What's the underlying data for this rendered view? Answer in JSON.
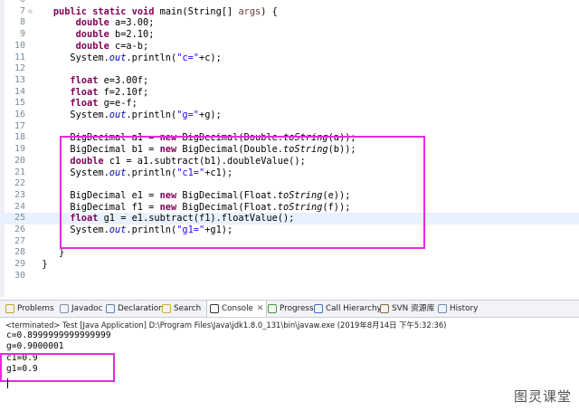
{
  "editor": {
    "lines": [
      {
        "n": "6",
        "tokens": [],
        "fold": ""
      },
      {
        "n": "7",
        "fold": "⊖",
        "tokens": [
          [
            "    ",
            ""
          ],
          [
            "public",
            "kw"
          ],
          [
            " ",
            ""
          ],
          [
            "static",
            "kw"
          ],
          [
            " ",
            ""
          ],
          [
            "void",
            "kw"
          ],
          [
            " main(String[] ",
            ""
          ],
          [
            "args",
            "pm"
          ],
          [
            ") {",
            ""
          ]
        ]
      },
      {
        "n": "8",
        "tokens": [
          [
            "        ",
            ""
          ],
          [
            "double",
            "kw"
          ],
          [
            " a=3.00;",
            ""
          ]
        ]
      },
      {
        "n": "9",
        "tokens": [
          [
            "        ",
            ""
          ],
          [
            "double",
            "kw"
          ],
          [
            " b=2.10;",
            ""
          ]
        ]
      },
      {
        "n": "10",
        "tokens": [
          [
            "        ",
            ""
          ],
          [
            "double",
            "kw"
          ],
          [
            " c=a-b;",
            ""
          ]
        ]
      },
      {
        "n": "11",
        "tokens": [
          [
            "       System.",
            ""
          ],
          [
            "out",
            "fld"
          ],
          [
            ".println(",
            ""
          ],
          [
            "\"c=\"",
            "st"
          ],
          [
            "+c);",
            ""
          ]
        ]
      },
      {
        "n": "12",
        "tokens": []
      },
      {
        "n": "13",
        "tokens": [
          [
            "       ",
            ""
          ],
          [
            "float",
            "kw"
          ],
          [
            " e=3.00f;",
            ""
          ]
        ]
      },
      {
        "n": "14",
        "tokens": [
          [
            "       ",
            ""
          ],
          [
            "float",
            "kw"
          ],
          [
            " f=2.10f;",
            ""
          ]
        ]
      },
      {
        "n": "15",
        "tokens": [
          [
            "       ",
            ""
          ],
          [
            "float",
            "kw"
          ],
          [
            " g=e-f;",
            ""
          ]
        ]
      },
      {
        "n": "16",
        "tokens": [
          [
            "       System.",
            ""
          ],
          [
            "out",
            "fld"
          ],
          [
            ".println(",
            ""
          ],
          [
            "\"g=\"",
            "st"
          ],
          [
            "+g);",
            ""
          ]
        ]
      },
      {
        "n": "17",
        "tokens": []
      },
      {
        "n": "18",
        "tokens": [
          [
            "       BigDecimal a1 = ",
            ""
          ],
          [
            "new",
            "kw"
          ],
          [
            " BigDecimal(Double.",
            ""
          ],
          [
            "toString",
            "sm"
          ],
          [
            "(a));",
            ""
          ]
        ]
      },
      {
        "n": "19",
        "tokens": [
          [
            "       BigDecimal b1 = ",
            ""
          ],
          [
            "new",
            "kw"
          ],
          [
            " BigDecimal(Double.",
            ""
          ],
          [
            "toString",
            "sm"
          ],
          [
            "(b));",
            ""
          ]
        ]
      },
      {
        "n": "20",
        "tokens": [
          [
            "       ",
            ""
          ],
          [
            "double",
            "kw"
          ],
          [
            " c1 = a1.subtract(b1).doubleValue();",
            ""
          ]
        ]
      },
      {
        "n": "21",
        "tokens": [
          [
            "       System.",
            ""
          ],
          [
            "out",
            "fld"
          ],
          [
            ".println(",
            ""
          ],
          [
            "\"c1=\"",
            "st"
          ],
          [
            "+c1);",
            ""
          ]
        ]
      },
      {
        "n": "22",
        "tokens": []
      },
      {
        "n": "23",
        "tokens": [
          [
            "       BigDecimal e1 = ",
            ""
          ],
          [
            "new",
            "kw"
          ],
          [
            " BigDecimal(Float.",
            ""
          ],
          [
            "toString",
            "sm"
          ],
          [
            "(e));",
            ""
          ]
        ]
      },
      {
        "n": "24",
        "tokens": [
          [
            "       BigDecimal f1 = ",
            ""
          ],
          [
            "new",
            "kw"
          ],
          [
            " BigDecimal(Float.",
            ""
          ],
          [
            "toString",
            "sm"
          ],
          [
            "(f));",
            ""
          ]
        ]
      },
      {
        "n": "25",
        "highlight": true,
        "tokens": [
          [
            "       ",
            ""
          ],
          [
            "float",
            "kw"
          ],
          [
            " g1 = e1.subtract(f1).floatValue();",
            ""
          ]
        ]
      },
      {
        "n": "26",
        "tokens": [
          [
            "       System.",
            ""
          ],
          [
            "out",
            "fld"
          ],
          [
            ".println(",
            ""
          ],
          [
            "\"g1=\"",
            "st"
          ],
          [
            "+g1);",
            ""
          ]
        ]
      },
      {
        "n": "27",
        "tokens": []
      },
      {
        "n": "28",
        "tokens": [
          [
            "     }",
            ""
          ]
        ]
      },
      {
        "n": "29",
        "tokens": [
          [
            "  }",
            ""
          ]
        ]
      },
      {
        "n": "30",
        "tokens": []
      }
    ]
  },
  "tabs": [
    {
      "label": "Problems",
      "icon": "problems-icon",
      "color": "#c9a227",
      "active": false
    },
    {
      "label": "Javadoc",
      "icon": "javadoc-icon",
      "color": "#7d8fa6",
      "active": false
    },
    {
      "label": "Declaration",
      "icon": "declaration-icon",
      "color": "#5a7fb5",
      "active": false
    },
    {
      "label": "Search",
      "icon": "search-icon",
      "color": "#d9a441",
      "active": false
    },
    {
      "label": "Console",
      "icon": "console-icon",
      "color": "#333333",
      "active": true,
      "close": "✕"
    },
    {
      "label": "Progress",
      "icon": "progress-icon",
      "color": "#4f9a3a",
      "active": false
    },
    {
      "label": "Call Hierarchy",
      "icon": "call-hierarchy-icon",
      "color": "#3a6fc4",
      "active": false
    },
    {
      "label": "SVN 资源库",
      "icon": "svn-repository-icon",
      "color": "#8a6a3a",
      "active": false
    },
    {
      "label": "History",
      "icon": "history-icon",
      "color": "#6b8fb8",
      "active": false
    }
  ],
  "console": {
    "status": "<terminated> Test [Java Application] D:\\Program Files\\Java\\jdk1.8.0_131\\bin\\javaw.exe (2019年8月14日 下午5:32:36)",
    "output": [
      "c=0.8999999999999999",
      "g=0.9000001",
      "c1=0.9",
      "g1=0.9"
    ]
  },
  "watermark": "图灵课堂",
  "colors": {
    "highlight_box": "#e62ae0",
    "keyword": "#7f0055",
    "string": "#2a00ff",
    "field": "#0000c0"
  }
}
